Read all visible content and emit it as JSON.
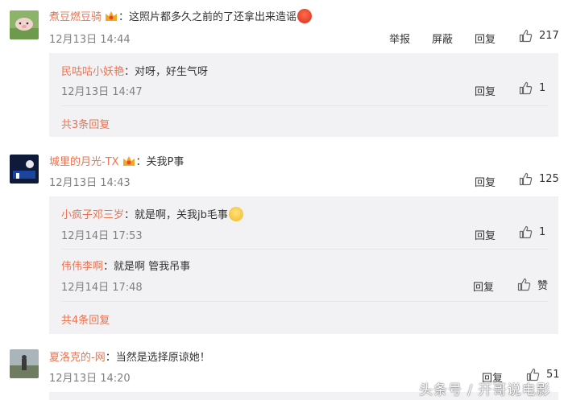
{
  "comments": [
    {
      "user": "煮豆燃豆骑",
      "text": "：这照片都多久之前的了还拿出来造谣",
      "time": "12月13日 14:44",
      "actions": [
        "举报",
        "屏蔽",
        "回复"
      ],
      "likes": "217",
      "replies": [
        {
          "user": "民咕咕小妖艳",
          "text": "：对呀，好生气呀",
          "time": "12月13日 14:47",
          "action": "回复",
          "likes": "1"
        }
      ],
      "more": "共3条回复"
    },
    {
      "user": "城里的月光-TX",
      "text": "：关我P事",
      "time": "12月13日 14:43",
      "actions": [
        "回复"
      ],
      "likes": "125",
      "replies": [
        {
          "user": "小疯子邓三岁",
          "text": "：就是啊，关我jb毛事",
          "time": "12月14日 17:53",
          "action": "回复",
          "likes": "1"
        },
        {
          "user": "伟伟李啊",
          "text": "：就是啊 管我吊事",
          "time": "12月14日 17:48",
          "action": "回复",
          "likes": "赞"
        }
      ],
      "more": "共4条回复"
    },
    {
      "user": "夏洛克的-网",
      "text": "：当然是选择原谅她！",
      "time": "12月13日 14:20",
      "actions": [
        "回复"
      ],
      "likes": "51"
    }
  ],
  "watermark": "头条号 / 开哥说电影",
  "colors": {
    "username": "#eb7350",
    "reply_bg": "#f2f2f5",
    "time": "#808080"
  }
}
